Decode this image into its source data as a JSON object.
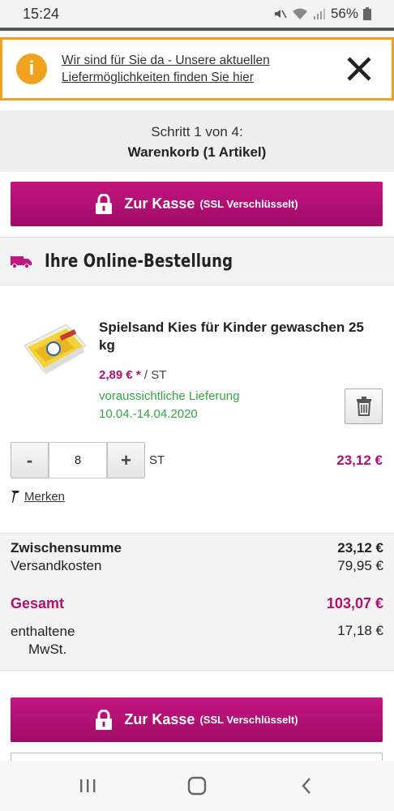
{
  "status_bar": {
    "time": "15:24",
    "battery": "56%"
  },
  "notice": {
    "icon": "info-icon",
    "line1": "Wir sind für Sie da - Unsere aktuellen",
    "line2": "Liefermöglichkeiten finden Sie hier"
  },
  "checkout_step": {
    "step": "Schritt 1 von 4:",
    "title": "Warenkorb (1 Artikel)"
  },
  "checkout_button": {
    "label": "Zur Kasse",
    "ssl": "(SSL Verschlüsselt)"
  },
  "order": {
    "title": "Ihre Online-Bestellung"
  },
  "product": {
    "name": "Spielsand Kies für Kinder gewaschen 25 kg",
    "price": "2,89 € *",
    "unit": " / ST",
    "delivery_label": "voraussichtliche Lieferung",
    "delivery_dates": "10.04.-14.04.2020",
    "quantity": "8",
    "quantity_unit": "ST",
    "minus": "-",
    "plus": "+",
    "line_total": "23,12 €",
    "merken": "Merken"
  },
  "summary": {
    "subtotal_label": "Zwischensumme",
    "subtotal_value": "23,12 €",
    "shipping_label": "Versandkosten",
    "shipping_value": "79,95 €",
    "total_label": "Gesamt",
    "total_value": "103,07 €",
    "vat_label_1": "enthaltene",
    "vat_label_2": "MwSt.",
    "vat_value": "17,18 €"
  },
  "colors": {
    "brand": "#b0106f",
    "notice": "#f0a21f",
    "delivery": "#32a844"
  }
}
